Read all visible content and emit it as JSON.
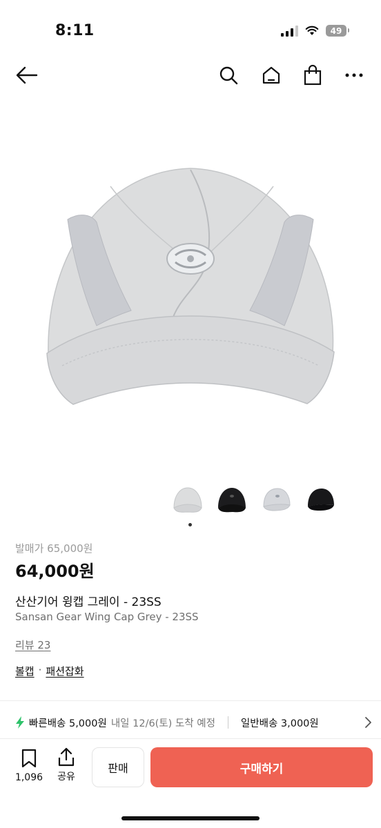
{
  "status_bar": {
    "time": "8:11",
    "battery": "49"
  },
  "product": {
    "original_price": "발매가 65,000원",
    "sale_price": "64,000원",
    "name_ko": "산산기어 윙캡 그레이 - 23SS",
    "name_en": "Sansan Gear Wing Cap Grey - 23SS",
    "review": "리뷰 23",
    "category_main": "볼캡",
    "category_separator": "·",
    "category_sub": "패션잡화",
    "thumbnails": [
      "grey-cap-front",
      "black-cap-front",
      "grey-cap-side",
      "black-cap-side"
    ],
    "selected_thumbnail": 0
  },
  "shipping": {
    "fast_label": "빠른배송 5,000원",
    "fast_detail": "내일 12/6(토) 도착 예정",
    "normal_label": "일반배송 3,000원"
  },
  "bottom_bar": {
    "like_count": "1,096",
    "share_label": "공유",
    "sell_label": "판매",
    "buy_label": "구매하기"
  },
  "colors": {
    "accent": "#ef6253",
    "bolt": "#2ec26a",
    "cap": "#d9dadb"
  }
}
